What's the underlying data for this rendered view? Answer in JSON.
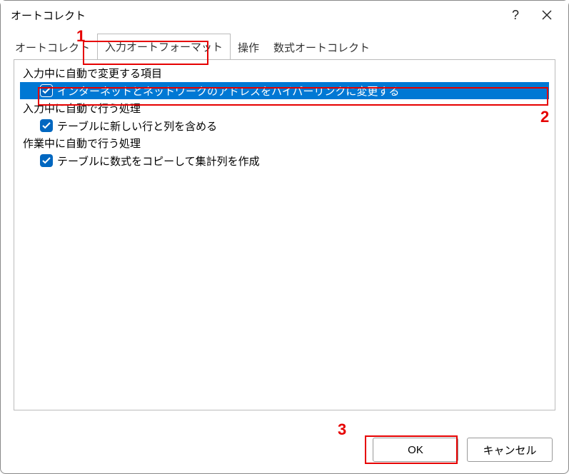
{
  "window": {
    "title": "オートコレクト"
  },
  "tabs": {
    "items": [
      {
        "label": "オートコレクト"
      },
      {
        "label": "入力オートフォーマット"
      },
      {
        "label": "操作"
      },
      {
        "label": "数式オートコレクト"
      }
    ],
    "activeIndex": 1
  },
  "groups": {
    "g0": {
      "label": "入力中に自動で変更する項目"
    },
    "g1": {
      "label": "入力中に自動で行う処理"
    },
    "g2": {
      "label": "作業中に自動で行う処理"
    }
  },
  "options": {
    "opt0": {
      "label": "インターネットとネットワークのアドレスをハイパーリンクに変更する"
    },
    "opt1": {
      "label": "テーブルに新しい行と列を含める"
    },
    "opt2": {
      "label": "テーブルに数式をコピーして集計列を作成"
    }
  },
  "buttons": {
    "ok": "OK",
    "cancel": "キャンセル"
  },
  "annotations": {
    "n1": "1",
    "n2": "2",
    "n3": "3"
  }
}
